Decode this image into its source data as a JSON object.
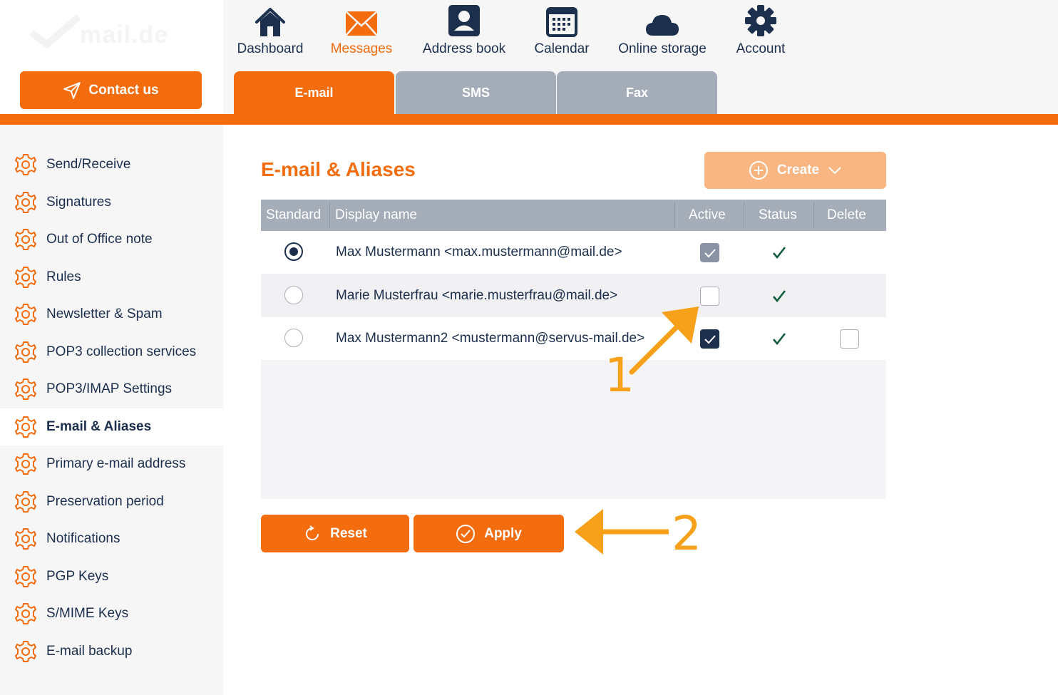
{
  "app": {
    "logo_text": "mail.de"
  },
  "contact_button": {
    "label": "Contact us"
  },
  "topnav": {
    "items": [
      {
        "label": "Dashboard",
        "icon": "home-icon"
      },
      {
        "label": "Messages",
        "icon": "envelope-icon",
        "active": true
      },
      {
        "label": "Address book",
        "icon": "contact-card-icon"
      },
      {
        "label": "Calendar",
        "icon": "calendar-icon"
      },
      {
        "label": "Online storage",
        "icon": "cloud-icon"
      },
      {
        "label": "Account",
        "icon": "gear-icon"
      }
    ]
  },
  "tabs": [
    {
      "label": "E-mail",
      "active": true
    },
    {
      "label": "SMS"
    },
    {
      "label": "Fax"
    }
  ],
  "sidebar": {
    "items": [
      {
        "label": "Send/Receive"
      },
      {
        "label": "Signatures"
      },
      {
        "label": "Out of Office note"
      },
      {
        "label": "Rules"
      },
      {
        "label": "Newsletter & Spam"
      },
      {
        "label": "POP3 collection services"
      },
      {
        "label": "POP3/IMAP Settings"
      },
      {
        "label": "E-mail & Aliases",
        "active": true
      },
      {
        "label": "Primary e-mail address"
      },
      {
        "label": "Preservation period"
      },
      {
        "label": "Notifications"
      },
      {
        "label": "PGP Keys"
      },
      {
        "label": "S/MIME Keys"
      },
      {
        "label": "E-mail backup"
      }
    ]
  },
  "main": {
    "title": "E-mail & Aliases",
    "create_button": "Create",
    "table": {
      "headers": {
        "standard": "Standard",
        "display_name": "Display name",
        "active": "Active",
        "status": "Status",
        "delete": "Delete"
      },
      "rows": [
        {
          "standard": true,
          "name": "Max Mustermann <max.mustermann@mail.de>",
          "active": "checked-disabled",
          "status": "ok",
          "delete": "none"
        },
        {
          "standard": false,
          "name": "Marie Musterfrau <marie.musterfrau@mail.de>",
          "active": "unchecked",
          "status": "ok",
          "delete": "none"
        },
        {
          "standard": false,
          "name": "Max Mustermann2 <mustermann@servus-mail.de>",
          "active": "checked",
          "status": "ok",
          "delete": "unchecked"
        }
      ]
    },
    "reset_button": "Reset",
    "apply_button": "Apply"
  },
  "annotations": {
    "step1": "1",
    "step2": "2"
  },
  "colors": {
    "brand_orange": "#f36c0d",
    "navy": "#1c2f4d",
    "annotation": "#f7a11b",
    "tab_grey": "#a5adb9"
  }
}
